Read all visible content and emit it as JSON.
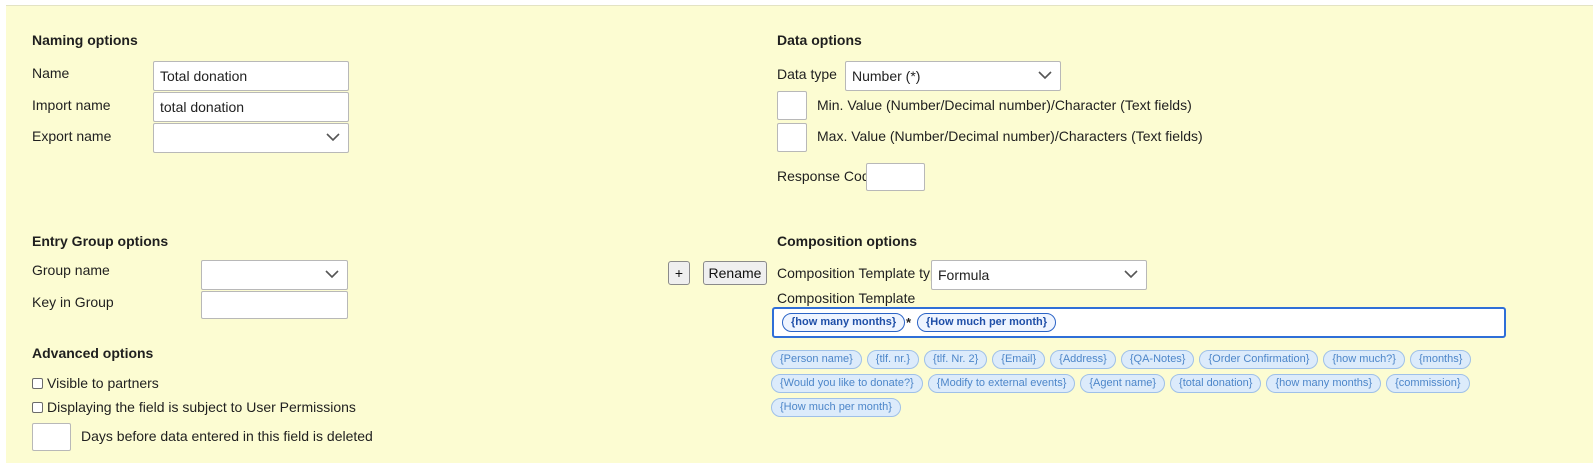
{
  "naming": {
    "heading": "Naming options",
    "name_label": "Name",
    "name_value": "Total donation",
    "import_label": "Import name",
    "import_value": "total donation",
    "export_label": "Export name",
    "export_value": ""
  },
  "data_options": {
    "heading": "Data options",
    "type_label": "Data type",
    "type_value": "Number (*)",
    "min_label": "Min. Value (Number/Decimal number)/Character (Text fields)",
    "min_value": "",
    "max_label": "Max. Value (Number/Decimal number)/Characters (Text fields)",
    "max_value": "",
    "response_label": "Response Code",
    "response_value": ""
  },
  "entry_group": {
    "heading": "Entry Group options",
    "group_label": "Group name",
    "group_value": "",
    "key_label": "Key in Group",
    "key_value": "",
    "add_label": "+",
    "rename_label": "Rename"
  },
  "advanced": {
    "heading": "Advanced options",
    "visible_label": "Visible to partners",
    "visible_checked": false,
    "permissions_label": "Displaying the field is subject to User Permissions",
    "permissions_checked": false,
    "days_value": "",
    "days_label": "Days before data entered in this field is deleted"
  },
  "composition": {
    "heading": "Composition options",
    "template_type_label": "Composition Template type",
    "template_type_value": "Formula",
    "template_label": "Composition Template",
    "template_tokens": [
      "{how many months}",
      "*",
      "{How much per month}"
    ],
    "variables": [
      "{Person name}",
      "{tlf. nr.}",
      "{tlf. Nr. 2}",
      "{Email}",
      "{Address}",
      "{QA-Notes}",
      "{Order Confirmation}",
      "{how much?}",
      "{months}",
      "{Would you like to donate?}",
      "{Modify to external events}",
      "{Agent name}",
      "{total donation}",
      "{how many months}",
      "{commission}",
      "{How much per month}"
    ]
  },
  "icons": {
    "dropdown": "chevron-down-icon"
  },
  "colors": {
    "panel_bg": "#fcfcd2",
    "focus_border": "#2f6fd8",
    "chip_fill": "#dcebfb"
  }
}
